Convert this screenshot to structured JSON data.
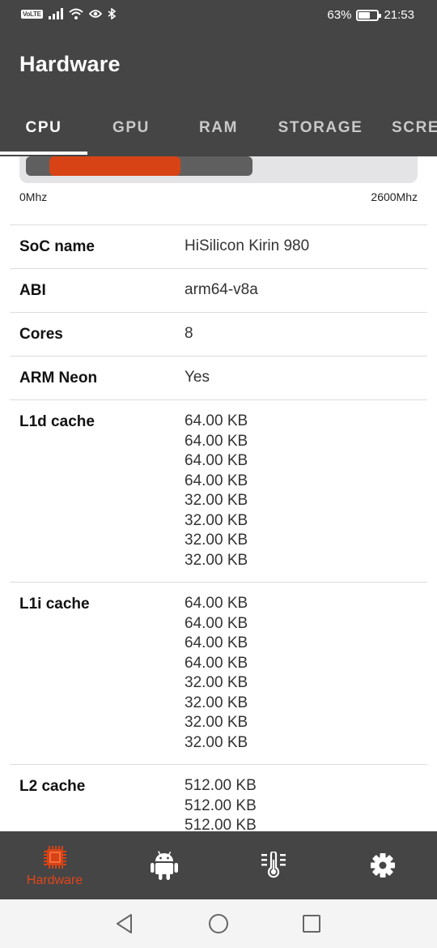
{
  "status_bar": {
    "network_badge": "VoLTE",
    "battery_percent": "63%",
    "battery_level": 0.63,
    "time": "21:53",
    "icons": [
      "volte-icon",
      "signal-icon",
      "wifi-icon",
      "eye-icon",
      "bluetooth-icon",
      "battery-icon"
    ]
  },
  "app_bar": {
    "title": "Hardware"
  },
  "tabs": [
    {
      "label": "CPU",
      "active": true
    },
    {
      "label": "GPU",
      "active": false
    },
    {
      "label": "RAM",
      "active": false
    },
    {
      "label": "STORAGE",
      "active": false
    },
    {
      "label": "SCREEN",
      "active": false
    }
  ],
  "frequency": {
    "min_label": "0Mhz",
    "max_label": "2600Mhz",
    "level_fraction": 0.58
  },
  "specs": [
    {
      "label": "SoC name",
      "values": [
        "HiSilicon Kirin 980"
      ]
    },
    {
      "label": "ABI",
      "values": [
        "arm64-v8a"
      ]
    },
    {
      "label": "Cores",
      "values": [
        "8"
      ]
    },
    {
      "label": "ARM Neon",
      "values": [
        "Yes"
      ]
    },
    {
      "label": "L1d cache",
      "values": [
        "64.00 KB",
        "64.00 KB",
        "64.00 KB",
        "64.00 KB",
        "32.00 KB",
        "32.00 KB",
        "32.00 KB",
        "32.00 KB"
      ]
    },
    {
      "label": "L1i cache",
      "values": [
        "64.00 KB",
        "64.00 KB",
        "64.00 KB",
        "64.00 KB",
        "32.00 KB",
        "32.00 KB",
        "32.00 KB",
        "32.00 KB"
      ]
    },
    {
      "label": "L2 cache",
      "values": [
        "512.00 KB",
        "512.00 KB",
        "512.00 KB"
      ]
    }
  ],
  "bottom_nav": {
    "items": [
      {
        "label": "Hardware",
        "icon": "cpu-chip-icon",
        "active": true
      },
      {
        "label": "",
        "icon": "android-icon",
        "active": false
      },
      {
        "label": "",
        "icon": "thermometer-icon",
        "active": false
      },
      {
        "label": "",
        "icon": "settings-gear-icon",
        "active": false
      }
    ]
  },
  "colors": {
    "accent": "#D84315",
    "app_bar": "#454545",
    "tab_inactive": "#C9C9C9"
  }
}
